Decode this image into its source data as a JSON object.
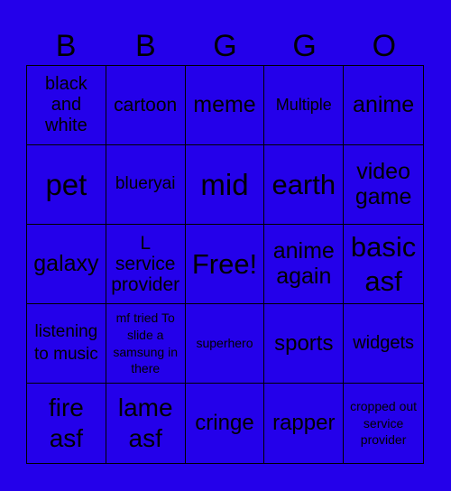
{
  "header": {
    "letters": [
      "B",
      "B",
      "G",
      "G",
      "O"
    ]
  },
  "colors": {
    "background": "#2400ea",
    "text": "#000000",
    "grid_line": "#000000"
  },
  "cells": [
    "black and white",
    "cartoon",
    "meme",
    "Multiple",
    "anime",
    "pet",
    "blueryai",
    "mid",
    "earth",
    "video game",
    "galaxy",
    "L service provider",
    "Free!",
    "anime again",
    "basic asf",
    "listening to music",
    "mf tried To slide a samsung in there",
    "superhero",
    "sports",
    "widgets",
    "fire asf",
    "lame asf",
    "cringe",
    "rapper",
    "cropped out service provider"
  ]
}
